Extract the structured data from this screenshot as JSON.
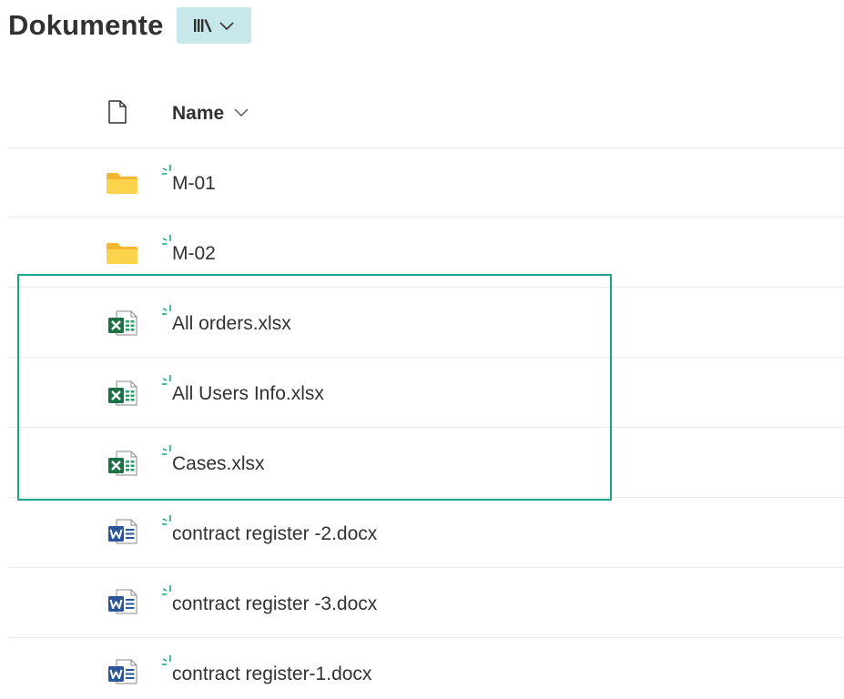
{
  "library": {
    "title": "Dokumente"
  },
  "list": {
    "header": {
      "name_label": "Name"
    },
    "items": [
      {
        "name": "M-01",
        "type": "folder"
      },
      {
        "name": "M-02",
        "type": "folder"
      },
      {
        "name": "All orders.xlsx",
        "type": "excel"
      },
      {
        "name": "All Users Info.xlsx",
        "type": "excel"
      },
      {
        "name": "Cases.xlsx",
        "type": "excel"
      },
      {
        "name": "contract register -2.docx",
        "type": "word"
      },
      {
        "name": "contract register -3.docx",
        "type": "word"
      },
      {
        "name": "contract register-1.docx",
        "type": "word"
      }
    ]
  },
  "colors": {
    "highlight": "#1aa58c",
    "view_switch_bg": "#c7e7ea",
    "excel_green": "#1e7145",
    "word_blue": "#2b579a",
    "folder_yellow": "#fcd34d",
    "new_badge": "#10a37f"
  },
  "icons": {
    "view_switch": "library-icon",
    "header": "document-icon",
    "sort": "chevron-down-icon",
    "new": "new-item-icon"
  }
}
